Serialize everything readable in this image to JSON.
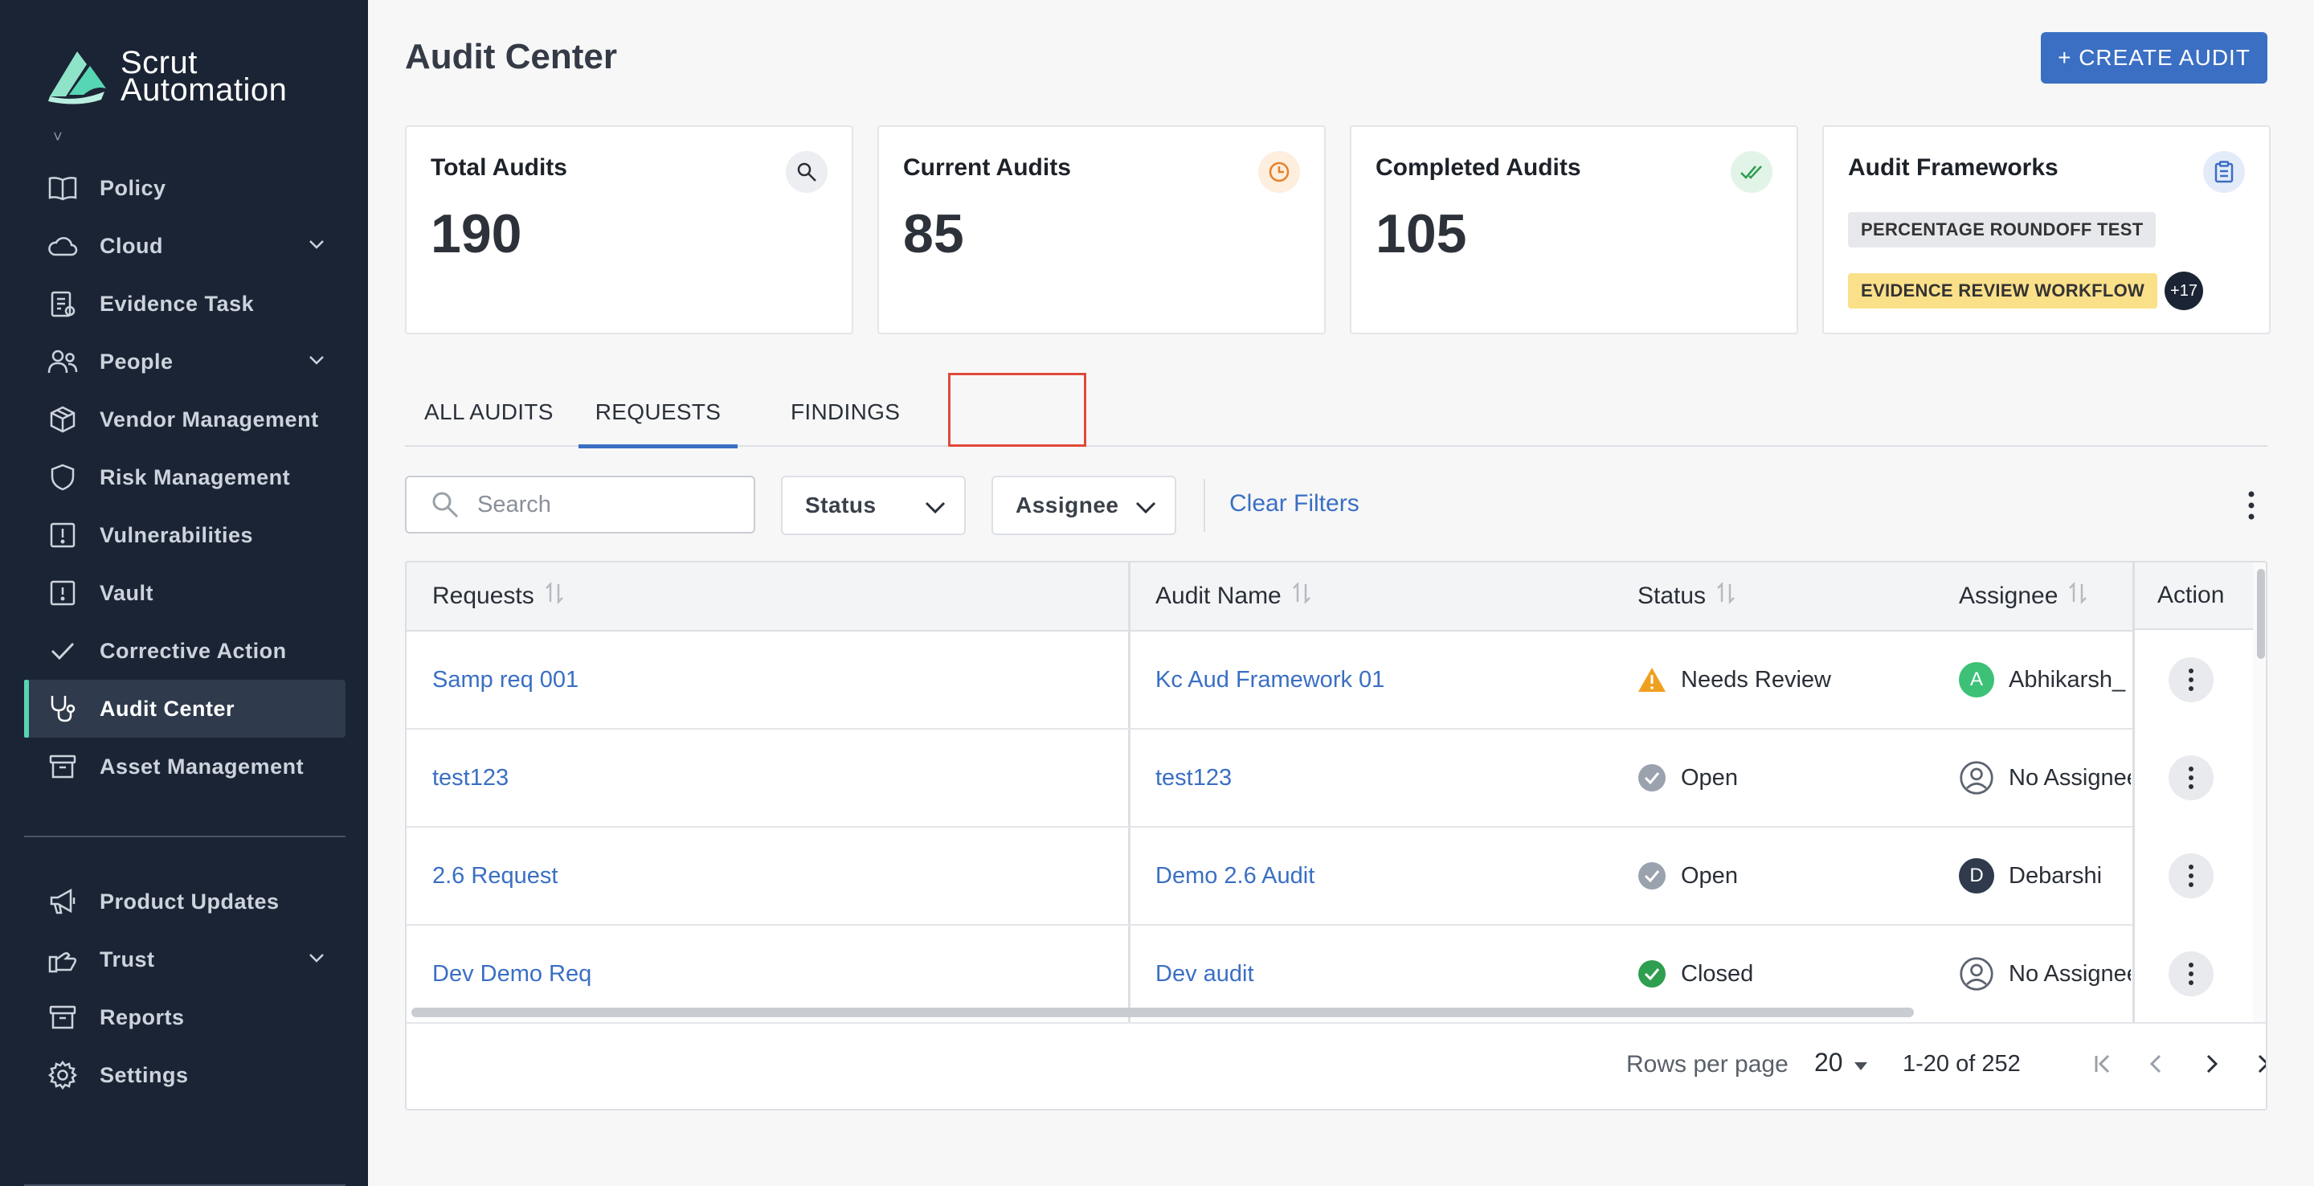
{
  "brand": {
    "name_line1": "Scrut",
    "name_line2": "Automation"
  },
  "sidebar": {
    "items": [
      {
        "label": "Policy",
        "icon": "book-icon"
      },
      {
        "label": "Cloud",
        "icon": "cloud-icon",
        "expandable": true
      },
      {
        "label": "Evidence Task",
        "icon": "clipboard-icon"
      },
      {
        "label": "People",
        "icon": "people-icon",
        "expandable": true
      },
      {
        "label": "Vendor Management",
        "icon": "box-icon"
      },
      {
        "label": "Risk Management",
        "icon": "shield-icon"
      },
      {
        "label": "Vulnerabilities",
        "icon": "alert-square-icon"
      },
      {
        "label": "Vault",
        "icon": "vault-icon"
      },
      {
        "label": "Corrective Action",
        "icon": "check-icon"
      },
      {
        "label": "Audit Center",
        "icon": "stethoscope-icon",
        "active": true
      },
      {
        "label": "Asset Management",
        "icon": "archive-icon"
      }
    ],
    "secondary": [
      {
        "label": "Product Updates",
        "icon": "megaphone-icon"
      },
      {
        "label": "Trust",
        "icon": "trust-icon",
        "expandable": true
      },
      {
        "label": "Reports",
        "icon": "archive-icon"
      },
      {
        "label": "Settings",
        "icon": "gear-icon"
      }
    ]
  },
  "header": {
    "title": "Audit Center",
    "create_button": "+ CREATE AUDIT"
  },
  "cards": {
    "total": {
      "title": "Total Audits",
      "value": "190"
    },
    "current": {
      "title": "Current Audits",
      "value": "85"
    },
    "completed": {
      "title": "Completed Audits",
      "value": "105"
    },
    "frameworks": {
      "title": "Audit Frameworks",
      "tags": [
        "PERCENTAGE ROUNDOFF TEST",
        "EVIDENCE REVIEW WORKFLOW"
      ],
      "more": "+17"
    }
  },
  "tabs": [
    "ALL AUDITS",
    "REQUESTS",
    "FINDINGS"
  ],
  "active_tab": "REQUESTS",
  "filters": {
    "search_placeholder": "Search",
    "status": "Status",
    "assignee": "Assignee",
    "clear": "Clear Filters"
  },
  "table": {
    "columns": [
      "Requests",
      "Audit Name",
      "Status",
      "Assignee",
      "Action"
    ],
    "rows": [
      {
        "request": "Samp req 001",
        "audit": "Kc Aud Framework 01",
        "status": "Needs Review",
        "status_kind": "warning",
        "assignee": "Abhikarsh_",
        "avatar": "A",
        "avatar_color": "#3cc177"
      },
      {
        "request": "test123",
        "audit": "test123",
        "status": "Open",
        "status_kind": "open",
        "assignee": "No Assignee",
        "avatar": "",
        "avatar_color": ""
      },
      {
        "request": "2.6 Request",
        "audit": "Demo 2.6 Audit",
        "status": "Open",
        "status_kind": "open",
        "assignee": "Debarshi",
        "avatar": "D",
        "avatar_color": "#2f3a4c"
      },
      {
        "request": "Dev Demo Req",
        "audit": "Dev audit",
        "status": "Closed",
        "status_kind": "closed",
        "assignee": "No Assignee",
        "avatar": "",
        "avatar_color": ""
      }
    ]
  },
  "pagination": {
    "rows_per_page_label": "Rows per page",
    "rows_per_page": "20",
    "range": "1-20 of 252"
  },
  "colors": {
    "accent": "#3a6fc3",
    "sidebar": "#1b2434",
    "active_marker": "#57d6b4",
    "warning": "#f0a020",
    "closed": "#2e9e4f"
  }
}
